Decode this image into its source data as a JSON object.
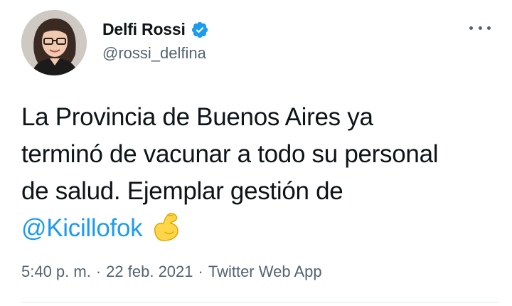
{
  "user": {
    "display_name": "Delfi Rossi",
    "handle": "@rossi_delfina",
    "verified": true,
    "avatar_icon": "profile-photo"
  },
  "tweet": {
    "lines": [
      "La Provincia de Buenos Aires ya",
      "terminó de vacunar a todo su personal",
      "de salud. Ejemplar gestión de"
    ],
    "mention": "@Kicillofok",
    "emoji_icon": "flexed-biceps-emoji"
  },
  "meta": {
    "time": "5:40 p. m.",
    "separator": "·",
    "date": "22 feb. 2021",
    "source": "Twitter Web App"
  },
  "colors": {
    "link": "#1d9bf0",
    "secondary_text": "#536471",
    "verified_badge": "#1d9bf0"
  }
}
